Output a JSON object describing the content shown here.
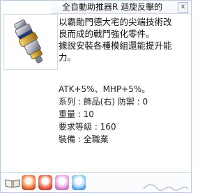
{
  "tooltip": {
    "title": "全自動助推器R 迴旋反擊的",
    "close_label": "x",
    "description": "以霸勛門德大宅的尖端技術改\n良而成的戰鬥強化零件。\n據說安裝各種模組還能提升能\n力。",
    "stats": [
      "ATK+5%、MHP+5%。",
      "系列 : 飾品(右)  防禦 : 0",
      "重量 : 10",
      "要求等級 : 160",
      "裝備 : 全職業"
    ]
  },
  "footer": {
    "icons": [
      "book-icon",
      "orange-gem-icon",
      "red-gem-icon",
      "pink-gem-icon",
      "blue-gem-icon"
    ]
  }
}
